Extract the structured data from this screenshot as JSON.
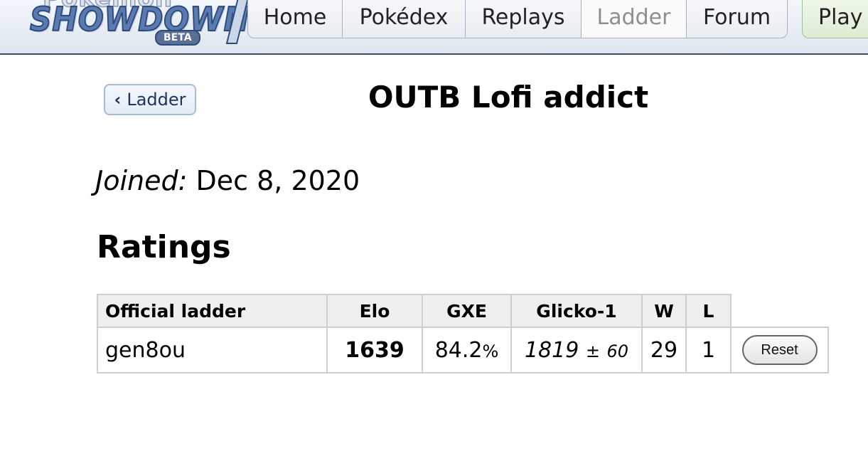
{
  "header": {
    "logo": {
      "top": "Pokémon",
      "main": "SHOWDOWN",
      "badge": "BETA"
    },
    "nav": [
      {
        "label": "Home"
      },
      {
        "label": "Pokédex"
      },
      {
        "label": "Replays"
      },
      {
        "label": "Ladder",
        "active": true
      },
      {
        "label": "Forum"
      }
    ],
    "play_label": "Play"
  },
  "back_button": {
    "label": "Ladder",
    "icon": "chevron-left-icon"
  },
  "user": {
    "name": "OUTB Lofi addict"
  },
  "joined": {
    "label": "Joined:",
    "date": "Dec 8, 2020"
  },
  "ratings": {
    "heading": "Ratings",
    "columns": [
      "Official ladder",
      "Elo",
      "GXE",
      "Glicko-1",
      "W",
      "L"
    ],
    "rows": [
      {
        "format": "gen8ou",
        "elo": "1639",
        "gxe_value": "84.2",
        "gxe_unit": "%",
        "glicko": "1819",
        "glicko_pm": "±",
        "glicko_dev": "60",
        "w": "29",
        "l": "1",
        "action": "Reset"
      }
    ]
  },
  "colors": {
    "header_border": "#3b4a66",
    "link": "#1e3560"
  }
}
